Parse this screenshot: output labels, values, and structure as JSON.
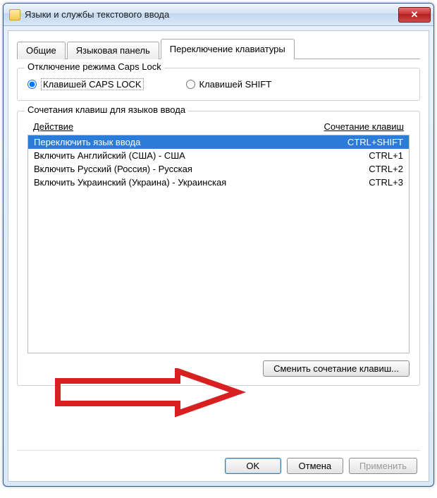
{
  "window": {
    "title": "Языки и службы текстового ввода"
  },
  "tabs": {
    "general": "Общие",
    "langbar": "Языковая панель",
    "switching": "Переключение клавиатуры"
  },
  "capslock_group": {
    "legend": "Отключение режима Caps Lock",
    "radio_caps": "Клавишей CAPS LOCK",
    "radio_shift": "Клавишей SHIFT"
  },
  "hotkeys_group": {
    "legend": "Сочетания клавиш для языков ввода",
    "col_action": "Действие",
    "col_keys": "Сочетание клавиш",
    "rows": [
      {
        "action": "Переключить язык ввода",
        "keys": "CTRL+SHIFT"
      },
      {
        "action": "Включить Английский (США) - США",
        "keys": "CTRL+1"
      },
      {
        "action": "Включить Русский (Россия) - Русская",
        "keys": "CTRL+2"
      },
      {
        "action": "Включить Украинский (Украина) - Украинская",
        "keys": "CTRL+3"
      }
    ],
    "change_button": "Сменить сочетание клавиш..."
  },
  "dialog_buttons": {
    "ok": "OK",
    "cancel": "Отмена",
    "apply": "Применить"
  }
}
